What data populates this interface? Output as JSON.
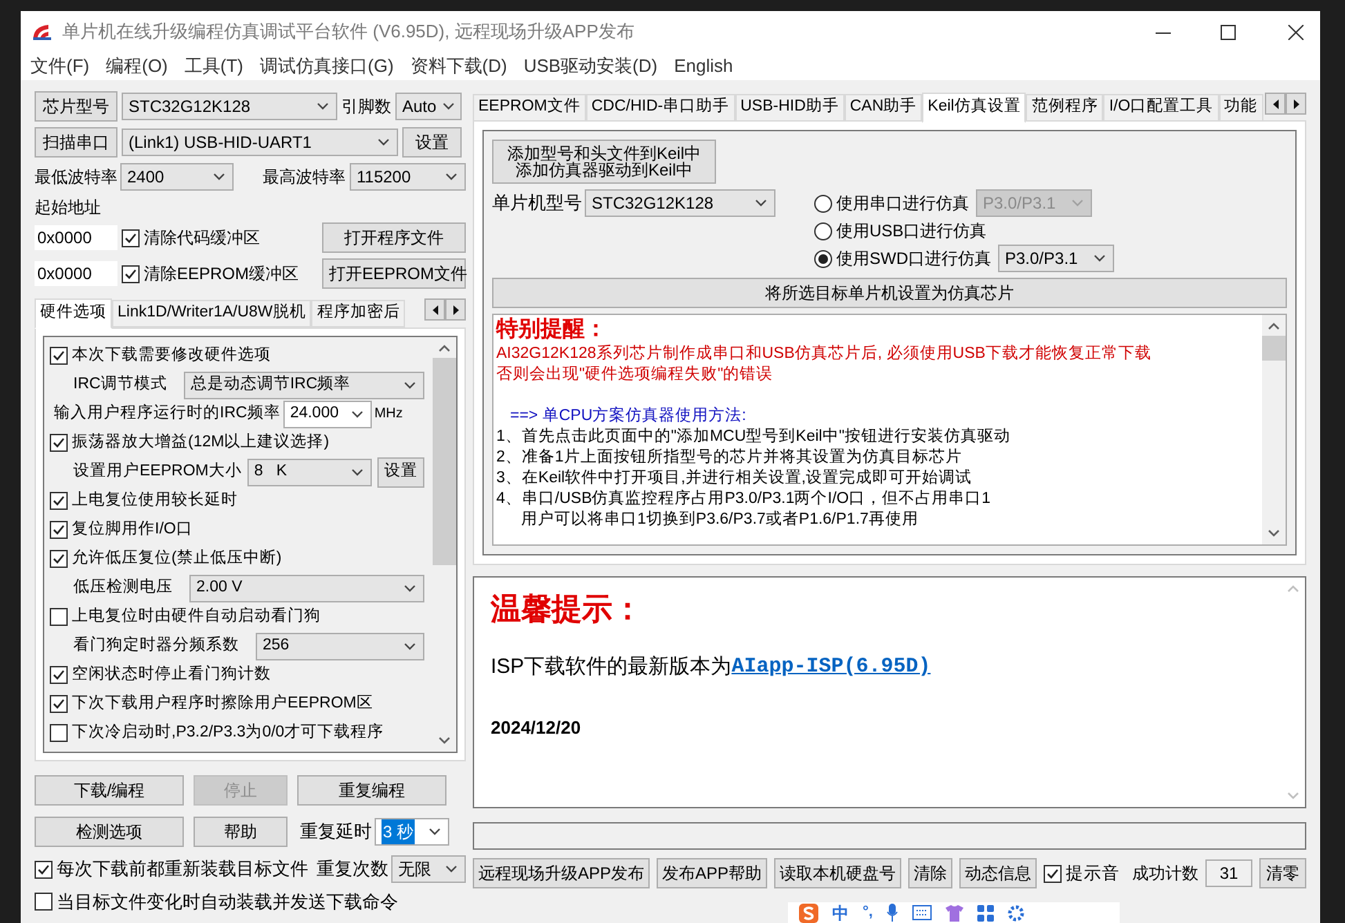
{
  "window": {
    "title": "单片机在线升级编程仿真调试平台软件 (V6.95D), 远程现场升级APP发布"
  },
  "menu": [
    "文件(F)",
    "编程(O)",
    "工具(T)",
    "调试仿真接口(G)",
    "资料下载(D)",
    "USB驱动安装(D)",
    "English"
  ],
  "left": {
    "chip": {
      "button": "芯片型号",
      "value": "STC32G12K128",
      "pins_label": "引脚数",
      "pins": "Auto"
    },
    "port": {
      "button": "扫描串口",
      "value": "(Link1) USB-HID-UART1",
      "settings": "设置"
    },
    "baud": {
      "min_label": "最低波特率",
      "min": "2400",
      "max_label": "最高波特率",
      "max": "115200"
    },
    "start_address_label": "起始地址",
    "files": [
      {
        "address": "0x0000",
        "label": "清除代码缓冲区",
        "checked": true,
        "button": "打开程序文件"
      },
      {
        "address": "0x0000",
        "label": "清除EEPROM缓冲区",
        "checked": true,
        "button": "打开EEPROM文件"
      }
    ],
    "tabs": [
      {
        "label": "硬件选项",
        "selected": true
      },
      {
        "label": "Link1D/Writer1A/U8W脱机",
        "selected": false
      },
      {
        "label": "程序加密后",
        "selected": false
      }
    ],
    "options": [
      {
        "kind": "check",
        "label": "本次下载需要修改硬件选项",
        "checked": true
      },
      {
        "kind": "select",
        "label": "IRC调节模式",
        "value": "总是动态调节IRC频率"
      },
      {
        "kind": "input",
        "label": "输入用户程序运行时的IRC频率",
        "value": "24.000",
        "unit": "MHz"
      },
      {
        "kind": "check",
        "label": "振荡器放大增益(12M以上建议选择)",
        "checked": true
      },
      {
        "kind": "select_button",
        "label": "设置用户EEPROM大小",
        "value": "8   K",
        "button": "设置"
      },
      {
        "kind": "check",
        "label": "上电复位使用较长延时",
        "checked": true
      },
      {
        "kind": "check",
        "label": "复位脚用作I/O口",
        "checked": true
      },
      {
        "kind": "check",
        "label": "允许低压复位(禁止低压中断)",
        "checked": true
      },
      {
        "kind": "select",
        "label": "低压检测电压",
        "value": "2.00 V"
      },
      {
        "kind": "check",
        "label": "上电复位时由硬件自动启动看门狗",
        "checked": false
      },
      {
        "kind": "select",
        "label": "看门狗定时器分频系数",
        "value": "256"
      },
      {
        "kind": "check",
        "label": "空闲状态时停止看门狗计数",
        "checked": true
      },
      {
        "kind": "check",
        "label": "下次下载用户程序时擦除用户EEPROM区",
        "checked": true
      },
      {
        "kind": "check",
        "label": "下次冷启动时,P3.2/P3.3为0/0才可下载程序",
        "checked": false
      }
    ],
    "actions": [
      {
        "label": "下载/编程",
        "disabled": false
      },
      {
        "label": "停止",
        "disabled": true
      },
      {
        "label": "重复编程",
        "disabled": false
      },
      {
        "label": "检测选项",
        "disabled": false
      },
      {
        "label": "帮助",
        "disabled": false
      }
    ],
    "repeat_delay": {
      "label": "重复延时",
      "value": "3 秒",
      "highlighted": true
    },
    "repeat_count": {
      "label": "重复次数",
      "value": "无限"
    },
    "bottom_checks": [
      {
        "label": "每次下载前都重新装载目标文件",
        "checked": true
      },
      {
        "label": "当目标文件变化时自动装载并发送下载命令",
        "checked": false
      }
    ]
  },
  "right": {
    "tabs": [
      {
        "label": "EEPROM文件",
        "selected": false
      },
      {
        "label": "CDC/HID-串口助手",
        "selected": false
      },
      {
        "label": "USB-HID助手",
        "selected": false
      },
      {
        "label": "CAN助手",
        "selected": false
      },
      {
        "label": "Keil仿真设置",
        "selected": true
      },
      {
        "label": "范例程序",
        "selected": false
      },
      {
        "label": "I/O口配置工具",
        "selected": false
      },
      {
        "label": "功能",
        "selected": false
      }
    ],
    "keil": {
      "add_button": [
        "添加型号和头文件到Keil中",
        "添加仿真器驱动到Keil中"
      ],
      "chip_label": "单片机型号",
      "chip": "STC32G12K128",
      "modes": [
        {
          "label": "使用串口进行仿真",
          "selected": false,
          "port": "P3.0/P3.1",
          "port_disabled": true
        },
        {
          "label": "使用USB口进行仿真",
          "selected": false
        },
        {
          "label": "使用SWD口进行仿真",
          "selected": true,
          "port": "P3.0/P3.1",
          "port_disabled": false
        }
      ],
      "set_button": "将所选目标单片机设置为仿真芯片",
      "notes": [
        {
          "kind": "heading",
          "text": "特别提醒："
        },
        {
          "kind": "warning",
          "text": "AI32G12K128系列芯片制作成串口和USB仿真芯片后, 必须使用USB下载才能恢复正常下载"
        },
        {
          "kind": "warning",
          "text": "否则会出现\"硬件选项编程失败\"的错误"
        },
        {
          "kind": "blank"
        },
        {
          "kind": "method",
          "text": "==> 单CPU方案仿真器使用方法:"
        },
        {
          "kind": "step",
          "text": "1、首先点击此页面中的\"添加MCU型号到Keil中\"按钮进行安装仿真驱动"
        },
        {
          "kind": "step",
          "text": "2、准备1片上面按钮所指型号的芯片并将其设置为仿真目标芯片"
        },
        {
          "kind": "step",
          "text": "3、在Keil软件中打开项目,并进行相关设置,设置完成即可开始调试"
        },
        {
          "kind": "step",
          "text": "4、串口/USB仿真监控程序占用P3.0/P3.1两个I/O口，但不占用串口1"
        },
        {
          "kind": "substep",
          "text": "用户可以将串口1切换到P3.6/P3.7或者P1.6/P1.7再使用"
        }
      ]
    },
    "tips": {
      "heading": "温馨提示：",
      "line": "ISP下载软件的最新版本为",
      "link": "AIapp-ISP(6.95D)",
      "date": "2024/12/20"
    },
    "footer": {
      "buttons": [
        "远程现场升级APP发布",
        "发布APP帮助",
        "读取本机硬盘号",
        "清除",
        "动态信息"
      ],
      "sound": {
        "label": "提示音",
        "checked": true
      },
      "count_label": "成功计数",
      "count": "31",
      "reset": "清零"
    }
  },
  "ime": {
    "mode": "中",
    "punct": "°,"
  }
}
